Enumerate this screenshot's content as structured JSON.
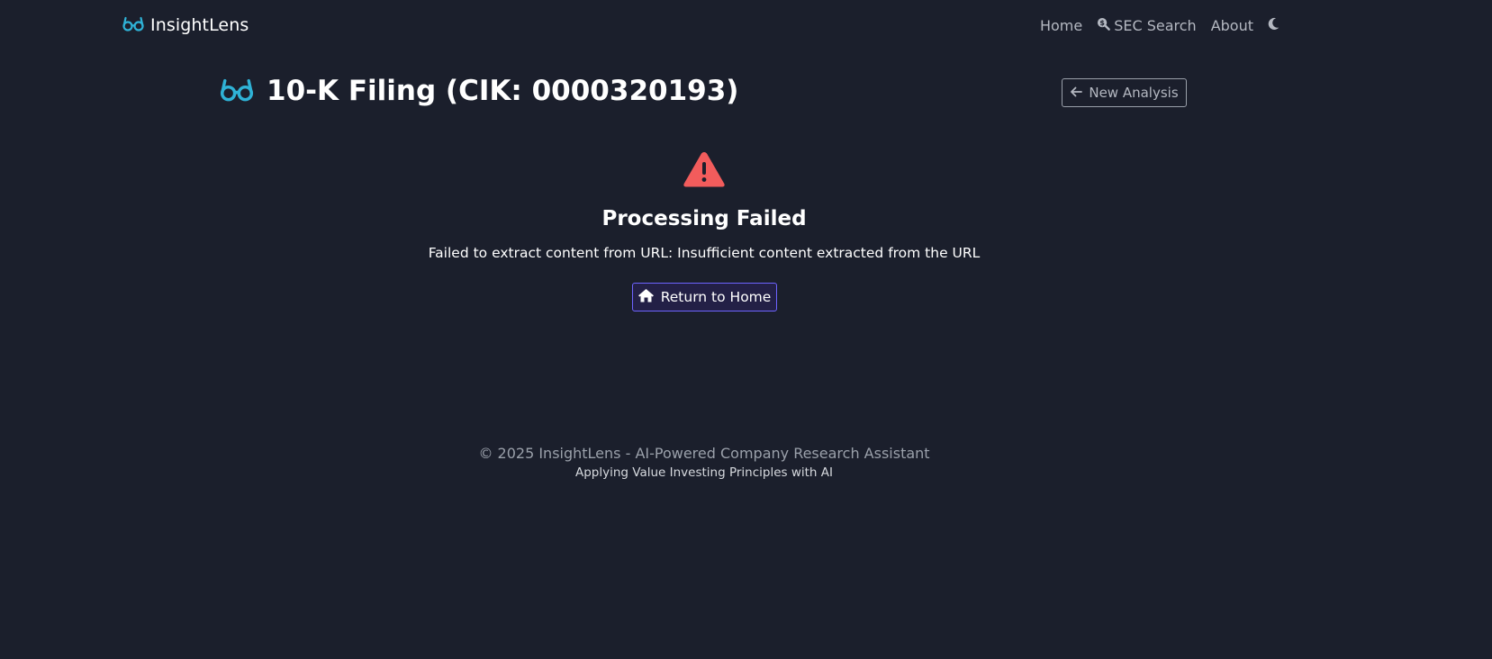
{
  "navbar": {
    "brand": "InsightLens",
    "brand_icon": "glasses-icon",
    "links": [
      {
        "label": "Home"
      },
      {
        "label": "SEC Search",
        "icon": "search-dollar-icon"
      },
      {
        "label": "About"
      }
    ],
    "theme_toggle_icon": "moon-icon"
  },
  "header": {
    "title": "10-K Filing (CIK: 0000320193)",
    "title_icon": "glasses-icon",
    "new_analysis_label": "New Analysis",
    "new_analysis_icon": "arrow-left-icon"
  },
  "error": {
    "icon": "warning-triangle-icon",
    "title": "Processing Failed",
    "message": "Failed to extract content from URL: Insufficient content extracted from the URL",
    "button_label": "Return to Home",
    "button_icon": "home-icon"
  },
  "footer": {
    "copyright": "© 2025 InsightLens - AI-Powered Company Research Assistant",
    "tagline": "Applying Value Investing Principles with AI"
  },
  "colors": {
    "background": "#1b1f2c",
    "accent_cyan": "#2fb2d6",
    "danger": "#f25c5c",
    "primary_outline": "#6e63ff",
    "muted_text": "#b4b8c1"
  }
}
